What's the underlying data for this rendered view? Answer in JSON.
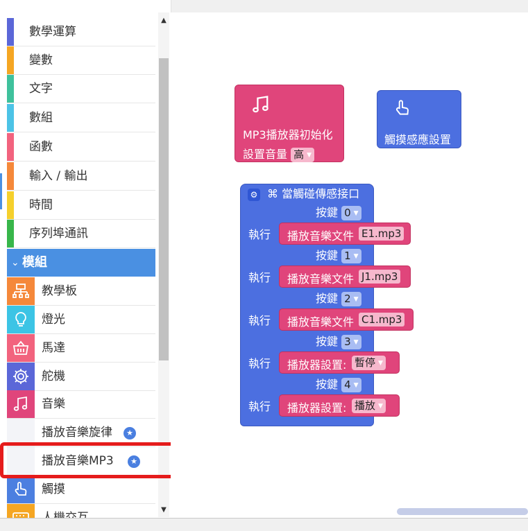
{
  "toolbox": {
    "categories": [
      {
        "label": "數學運算",
        "color": "#5b67d8"
      },
      {
        "label": "變數",
        "color": "#f5a623"
      },
      {
        "label": "文字",
        "color": "#3fc19c"
      },
      {
        "label": "數組",
        "color": "#4cc3e6"
      },
      {
        "label": "函數",
        "color": "#f2637e"
      },
      {
        "label": "輸入 / 輸出",
        "color": "#f5883a"
      },
      {
        "label": "時間",
        "color": "#f5d02c"
      },
      {
        "label": "序列埠通訊",
        "color": "#38b64a"
      }
    ],
    "modules_label": "模組",
    "modules_chevron": "›",
    "module_items": [
      {
        "label": "教學板",
        "icon": "board-icon",
        "color": "#f5883a"
      },
      {
        "label": "燈光",
        "icon": "bulb-icon",
        "color": "#3cc4e5"
      },
      {
        "label": "馬達",
        "icon": "motor-icon",
        "color": "#f2637e"
      },
      {
        "label": "舵機",
        "icon": "servo-gear-icon",
        "color": "#5b67d8"
      },
      {
        "label": "音樂",
        "icon": "music-note-icon",
        "color": "#e0457b"
      }
    ],
    "sub_items": [
      {
        "label": "播放音樂旋律",
        "badge": "★"
      },
      {
        "label": "播放音樂MP3",
        "badge": "★"
      }
    ],
    "bottom_items": [
      {
        "label": "觸摸",
        "icon": "touch-hand-icon",
        "color": "#4c7fe0"
      },
      {
        "label": "人機交互",
        "icon": "keyboard-icon",
        "color": "#f5a623"
      }
    ]
  },
  "blocks": {
    "mp3_init": {
      "title": "MP3播放器初始化",
      "volume_label": "設置音量",
      "volume_value": "高"
    },
    "touch_setup": {
      "title": "觸摸感應設置"
    },
    "touch_handler": {
      "title": "⌘ 當觸碰傳感接口",
      "key_label": "按鍵",
      "exec_label": "執行",
      "cases": [
        {
          "key": "0",
          "action": "播放音樂文件",
          "value": "E1.mp3",
          "type": "text"
        },
        {
          "key": "1",
          "action": "播放音樂文件",
          "value": "J1.mp3",
          "type": "text"
        },
        {
          "key": "2",
          "action": "播放音樂文件",
          "value": "C1.mp3",
          "type": "text"
        },
        {
          "key": "3",
          "action": "播放器設置:",
          "value": "暫停",
          "type": "dropdown"
        },
        {
          "key": "4",
          "action": "播放器設置:",
          "value": "播放",
          "type": "dropdown"
        }
      ]
    }
  },
  "colors": {
    "highlight": "#e51c1c",
    "block_pink": "#e0457b",
    "block_blue": "#4c6fe0",
    "selected_category": "#4a90e2"
  }
}
